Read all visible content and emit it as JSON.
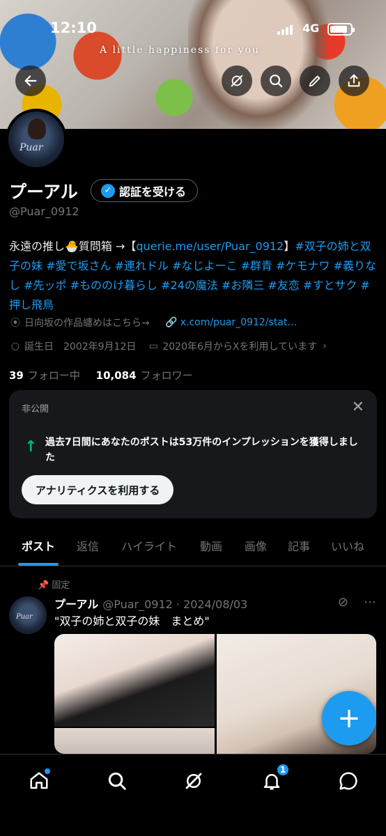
{
  "status_bar": {
    "time": "12:10",
    "network": "4G"
  },
  "banner": {
    "text": "A little happiness for you"
  },
  "profile": {
    "name": "プーアル",
    "verify_label": "認証を受ける",
    "handle": "@Puar_0912",
    "bio_prefix": "永遠の推し🐣質問箱 →【",
    "bio_link": "querie.me/user/Puar_0912",
    "bio_bracket": "】",
    "bio_tags": "#双子の姉と双子の妹 #愛で坂さん #連れドル #なじよーこ #群青 #ケモナワ #義りなし #先ッポ #もののけ暮らし #24の魔法 #お隣三 #友恋 #すとサク #押し飛鳥",
    "location": "日向坂の作品纏めはこちら→",
    "website": "x.com/puar_0912/stat…",
    "birthday": "誕生日　2002年9月12日",
    "joined": "2020年6月からXを利用しています",
    "following_count": "39",
    "following_label": "フォロー中",
    "followers_count": "10,084",
    "followers_label": "フォロワー"
  },
  "private_card": {
    "caption": "非公開",
    "message": "過去7日間にあなたのポストは53万件のインプレッションを獲得しました",
    "action_label": "アナリティクスを利用する"
  },
  "tabs": [
    "ポスト",
    "返信",
    "ハイライト",
    "動画",
    "画像",
    "記事",
    "いいね"
  ],
  "pinned_post": {
    "pinned_label": "固定",
    "author": "プーアル",
    "handle_date": "@Puar_0912 · 2024/08/03",
    "text": "\"双子の姉と双子の妹　まとめ\""
  },
  "avatar_signature": "Puar",
  "nav": {
    "notification_count": "1"
  },
  "colors": {
    "accent": "#1d9bf0",
    "success": "#00ba7c",
    "background": "#000000"
  }
}
